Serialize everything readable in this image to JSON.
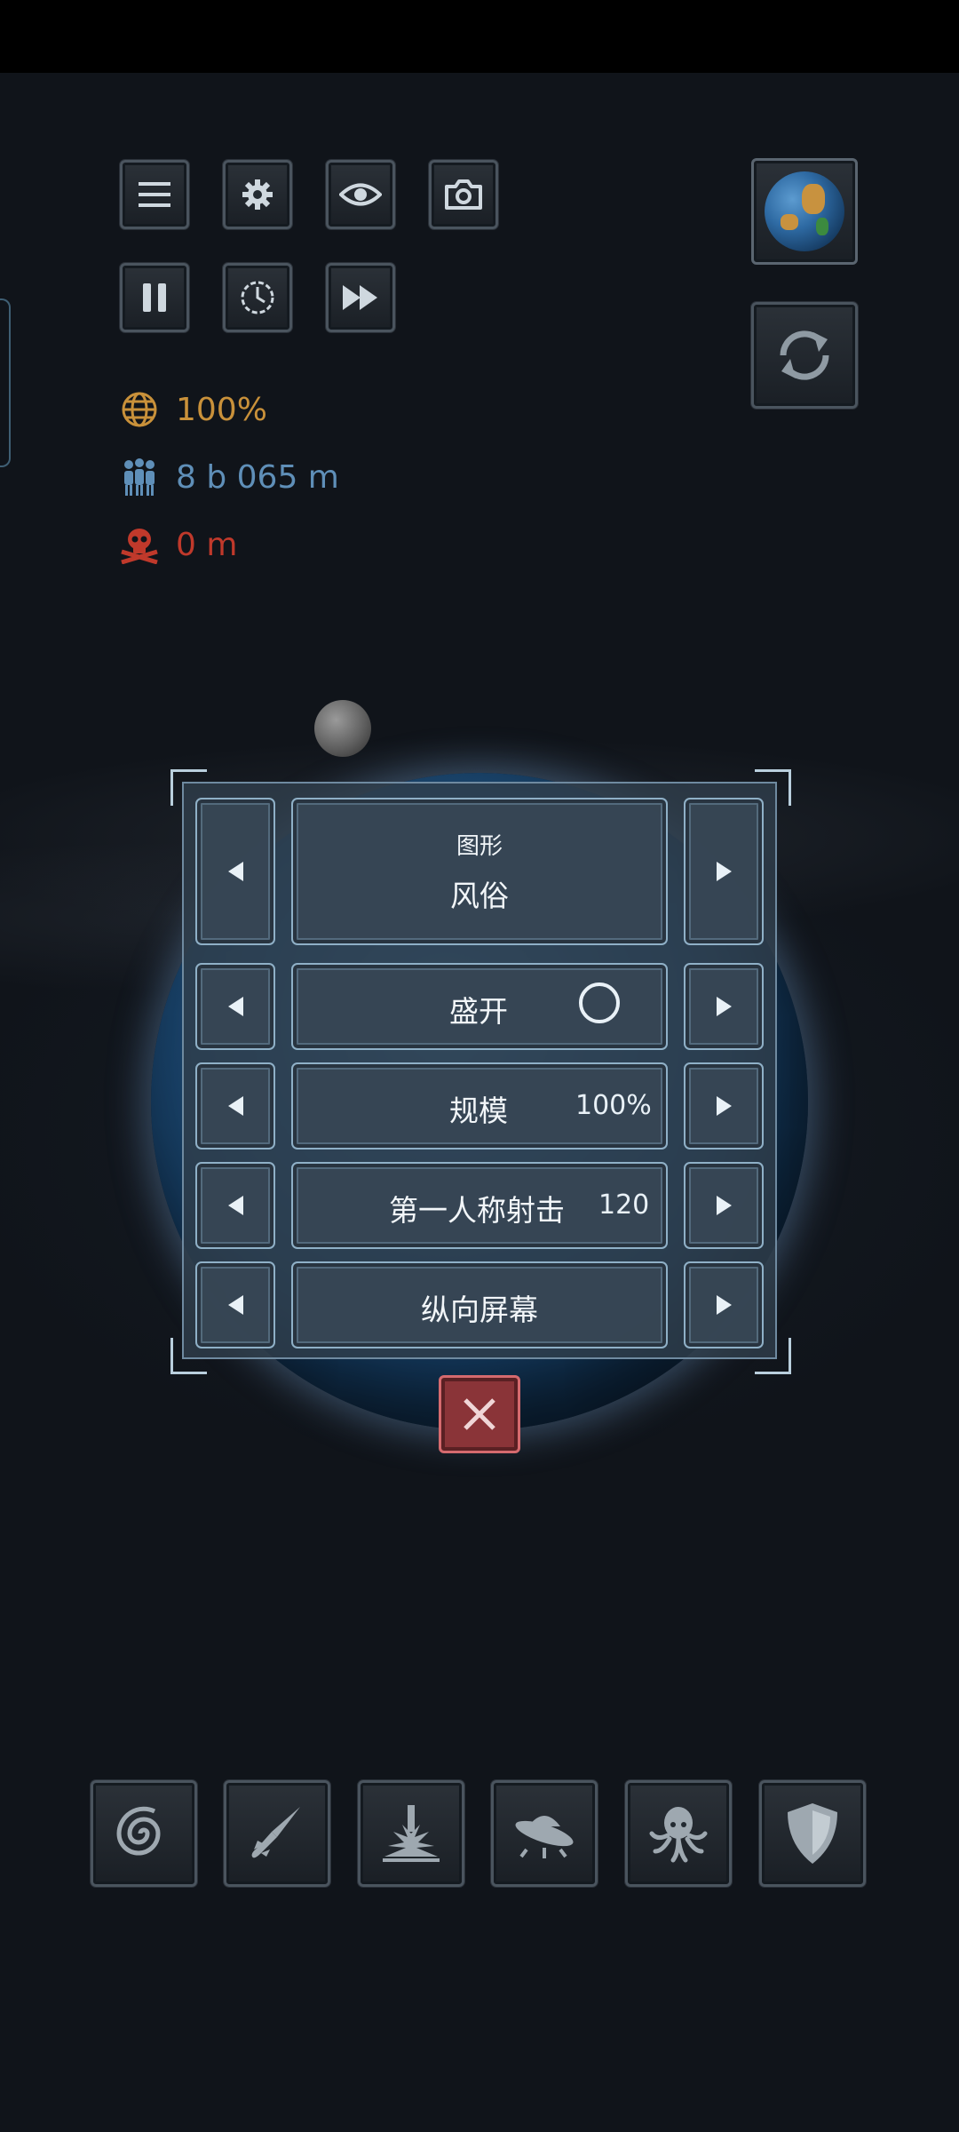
{
  "hud": {
    "stats": {
      "infection": "100%",
      "population": "8 b 065 m",
      "deaths": "0 m"
    }
  },
  "dialog": {
    "row1": {
      "subtitle": "图形",
      "title": "风俗"
    },
    "row2": {
      "label": "盛开"
    },
    "row3": {
      "label": "规模",
      "value": "100%"
    },
    "row4": {
      "label": "第一人称射击",
      "value": "120"
    },
    "row5": {
      "label": "纵向屏幕"
    }
  },
  "colors": {
    "infection": "#c9913a",
    "population": "#5f8fb8",
    "deaths": "#c0392b",
    "close": "#8a3438"
  },
  "icons": {
    "top_row1": [
      "menu-icon",
      "gear-icon",
      "eye-icon",
      "camera-icon"
    ],
    "top_row2": [
      "pause-icon",
      "clock-icon",
      "fast-forward-icon"
    ],
    "right": [
      "earth-icon",
      "refresh-icon"
    ],
    "bottom": [
      "spiral-galaxy-icon",
      "missile-icon",
      "blast-icon",
      "ufo-icon",
      "octopus-icon",
      "shield-icon"
    ]
  }
}
